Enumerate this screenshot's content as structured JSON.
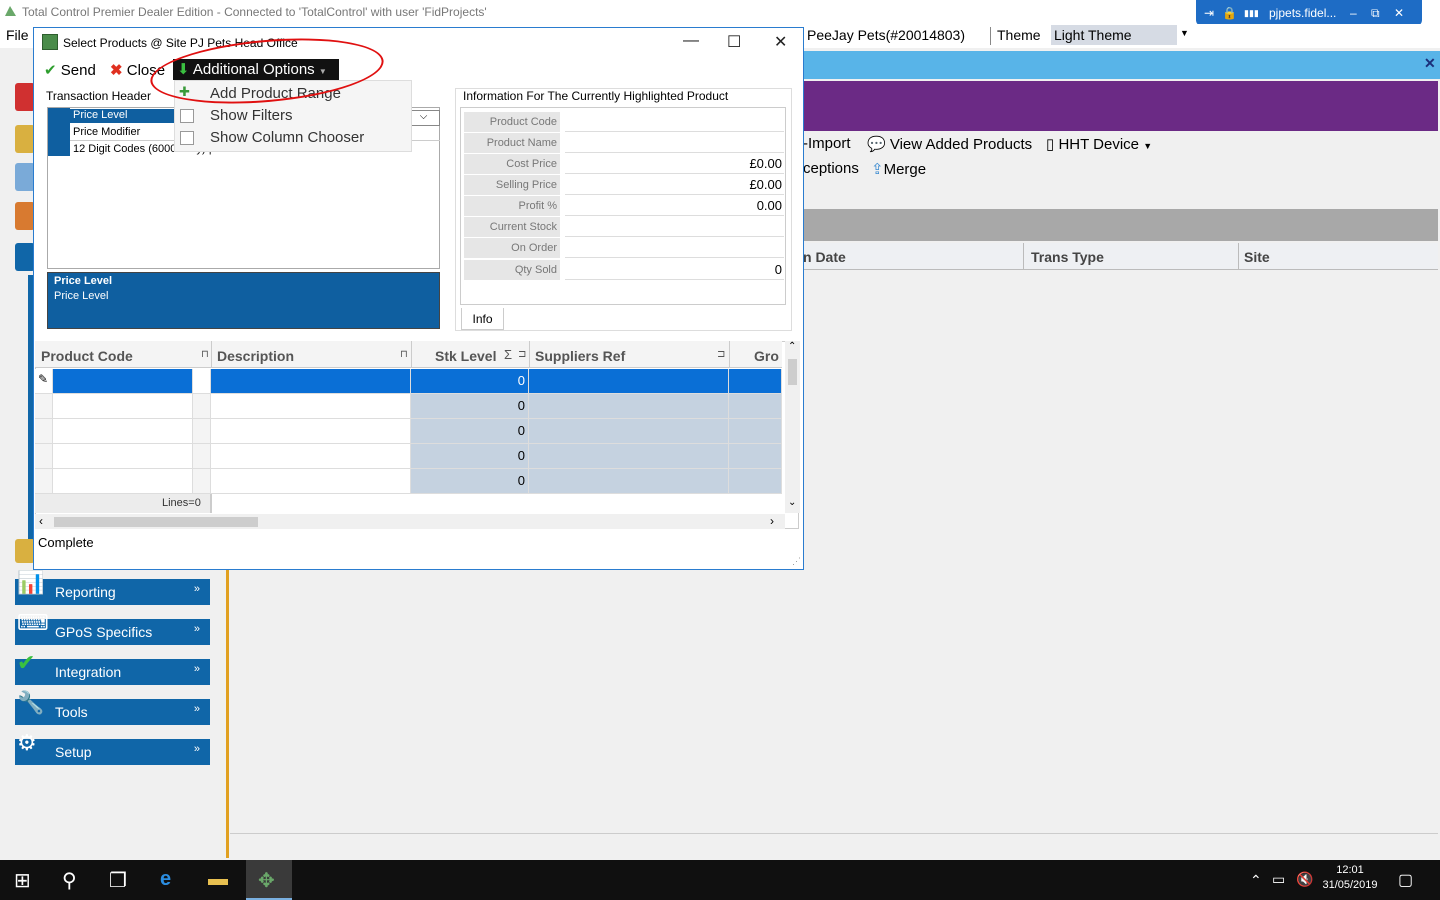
{
  "app": {
    "title": "Total Control Premier Dealer Edition - Connected to 'TotalControl' with user 'FidProjects'",
    "remote_host": "pjpets.fidel...",
    "remote_controls": [
      "⇥",
      "🔒",
      "▮▮▮",
      "–",
      "⧉",
      "✕"
    ]
  },
  "menubar": {
    "file": "File",
    "company": "PeeJay Pets(#20014803)",
    "theme_label": "Theme",
    "theme_value": "Light Theme"
  },
  "main_toolbar": {
    "import": "Import",
    "view_added": "View Added Products",
    "hht_device": "HHT Device",
    "exceptions": "ceptions",
    "merge": "Merge"
  },
  "main_grid": {
    "columns": [
      "n Date",
      "Trans Type",
      "Site"
    ]
  },
  "nav": {
    "items": [
      {
        "label": "Reporting",
        "icon": "📊"
      },
      {
        "label": "GPoS Specifics",
        "icon": "⌨"
      },
      {
        "label": "Integration",
        "icon": "✔"
      },
      {
        "label": "Tools",
        "icon": "🔧"
      },
      {
        "label": "Setup",
        "icon": "⚙"
      }
    ]
  },
  "dialog": {
    "title": "Select Products @ Site PJ Pets Head Office",
    "send": "Send",
    "close": "Close",
    "additional_options": "Additional Options",
    "menu": [
      "Add Product Range",
      "Show Filters",
      "Show Column Chooser"
    ],
    "transaction_header": "Transaction Header",
    "header_rows": [
      "Price Level",
      "Price Modifier",
      "12 Digit Codes (6000 Only) |False"
    ],
    "desc_title": "Price Level",
    "desc_text": "Price Level",
    "info_title": "Information For The Currently Highlighted Product",
    "info_rows": [
      {
        "label": "Product Code",
        "value": ""
      },
      {
        "label": "Product Name",
        "value": ""
      },
      {
        "label": "Cost Price",
        "value": "£0.00"
      },
      {
        "label": "Selling Price",
        "value": "£0.00"
      },
      {
        "label": "Profit %",
        "value": "0.00"
      },
      {
        "label": "Current Stock",
        "value": ""
      },
      {
        "label": "On Order",
        "value": ""
      },
      {
        "label": "Qty Sold",
        "value": "0"
      }
    ],
    "info_tab": "Info",
    "grid_columns": [
      "Product Code",
      "Description",
      "Stk Level",
      "Suppliers Ref",
      "Gro"
    ],
    "grid_rows": [
      "0",
      "0",
      "0",
      "0",
      "0"
    ],
    "lines": "Lines=0",
    "status": "Complete"
  },
  "taskbar": {
    "time": "12:01",
    "date": "31/05/2019"
  },
  "colors": {
    "accent_blue": "#1066a8",
    "selection_blue": "#0f5fa0",
    "purple_band": "#6b2a85",
    "annotation_red": "#e01010"
  }
}
